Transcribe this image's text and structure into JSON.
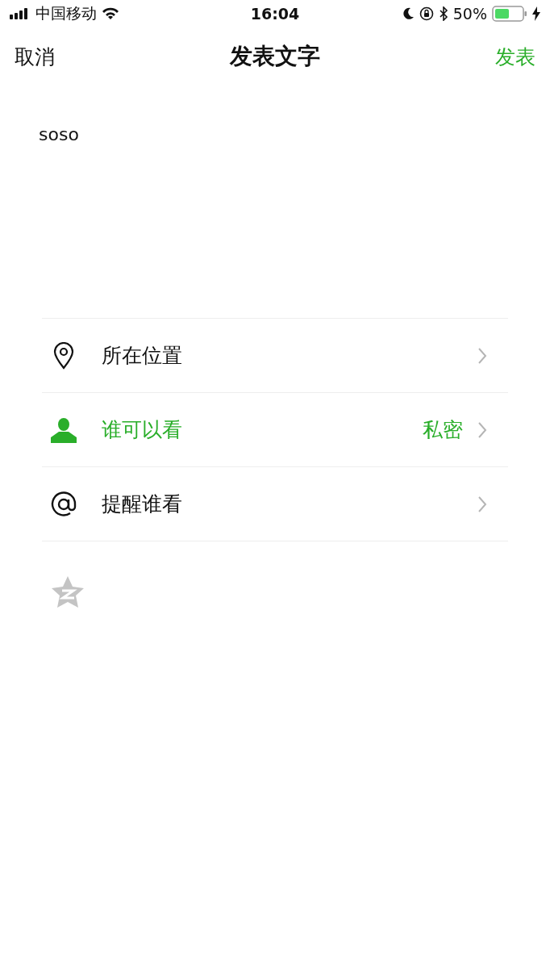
{
  "status_bar": {
    "carrier": "中国移动",
    "time": "16:04",
    "battery": "50%"
  },
  "nav": {
    "cancel": "取消",
    "title": "发表文字",
    "publish": "发表"
  },
  "post": {
    "value": "soso"
  },
  "options": [
    {
      "kind": "location",
      "label": "所在位置",
      "active": false
    },
    {
      "kind": "visibility",
      "label": "谁可以看",
      "value": "私密",
      "active": true
    },
    {
      "kind": "mention",
      "label": "提醒谁看",
      "active": false
    }
  ],
  "share_qzone": {
    "on": false
  }
}
